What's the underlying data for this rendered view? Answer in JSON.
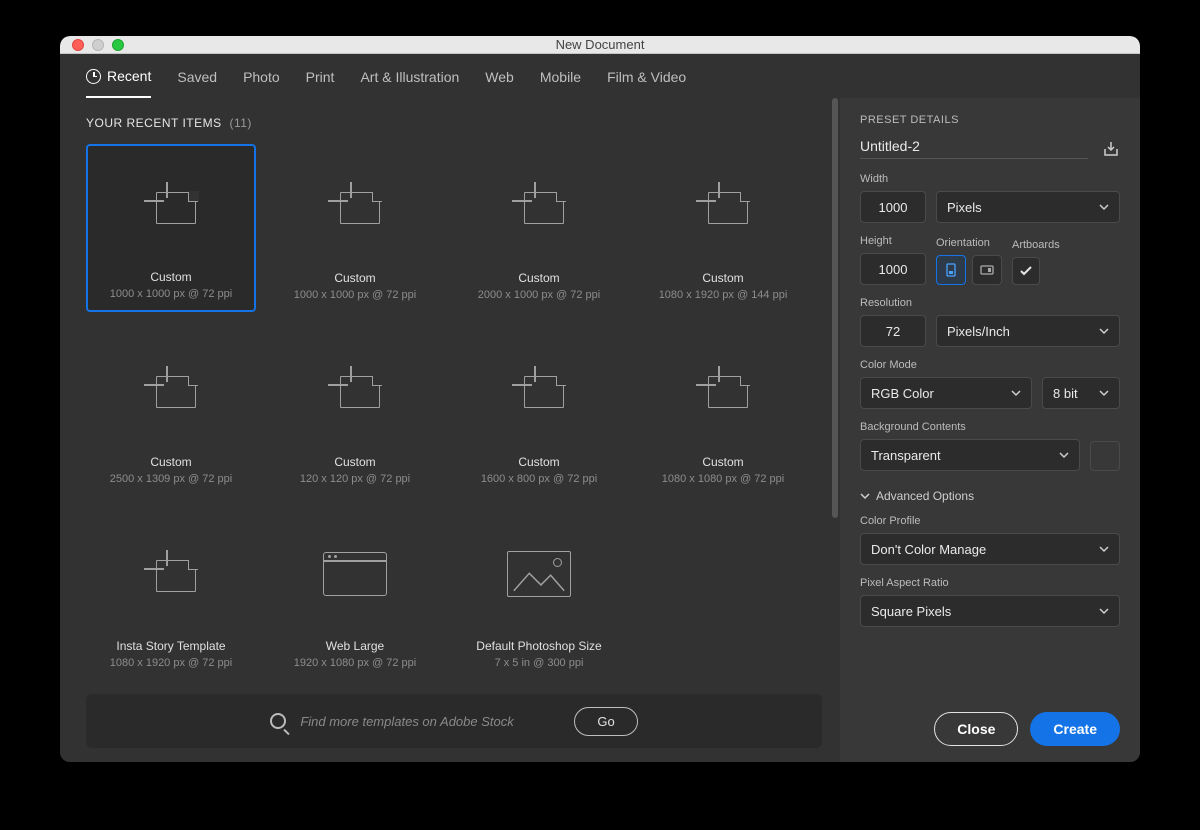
{
  "window": {
    "title": "New Document"
  },
  "tabs": [
    {
      "label": "Recent",
      "active": true
    },
    {
      "label": "Saved"
    },
    {
      "label": "Photo"
    },
    {
      "label": "Print"
    },
    {
      "label": "Art & Illustration"
    },
    {
      "label": "Web"
    },
    {
      "label": "Mobile"
    },
    {
      "label": "Film & Video"
    }
  ],
  "recent": {
    "heading": "YOUR RECENT ITEMS",
    "count": "(11)",
    "items": [
      {
        "title": "Custom",
        "sub": "1000 x 1000 px @ 72 ppi",
        "icon": "page",
        "selected": true
      },
      {
        "title": "Custom",
        "sub": "1000 x 1000 px @ 72 ppi",
        "icon": "page"
      },
      {
        "title": "Custom",
        "sub": "2000 x 1000 px @ 72 ppi",
        "icon": "page"
      },
      {
        "title": "Custom",
        "sub": "1080 x 1920 px @ 144 ppi",
        "icon": "page"
      },
      {
        "title": "Custom",
        "sub": "2500 x 1309 px @ 72 ppi",
        "icon": "page"
      },
      {
        "title": "Custom",
        "sub": "120 x 120 px @ 72 ppi",
        "icon": "page"
      },
      {
        "title": "Custom",
        "sub": "1600 x 800 px @ 72 ppi",
        "icon": "page"
      },
      {
        "title": "Custom",
        "sub": "1080 x 1080 px @ 72 ppi",
        "icon": "page"
      },
      {
        "title": "Insta Story Template",
        "sub": "1080 x 1920 px @ 72 ppi",
        "icon": "page"
      },
      {
        "title": "Web Large",
        "sub": "1920 x 1080 px @ 72 ppi",
        "icon": "browser"
      },
      {
        "title": "Default Photoshop Size",
        "sub": "7 x 5 in @ 300 ppi",
        "icon": "photo"
      }
    ]
  },
  "search": {
    "placeholder": "Find more templates on Adobe Stock",
    "go": "Go"
  },
  "preset": {
    "heading": "PRESET DETAILS",
    "docname": "Untitled-2",
    "width_label": "Width",
    "width_value": "1000",
    "width_unit": "Pixels",
    "height_label": "Height",
    "height_value": "1000",
    "orientation_label": "Orientation",
    "artboards_label": "Artboards",
    "artboards_checked": true,
    "resolution_label": "Resolution",
    "resolution_value": "72",
    "resolution_unit": "Pixels/Inch",
    "color_mode_label": "Color Mode",
    "color_mode": "RGB Color",
    "bit_depth": "8 bit",
    "bg_label": "Background Contents",
    "bg_value": "Transparent",
    "advanced_label": "Advanced Options",
    "color_profile_label": "Color Profile",
    "color_profile": "Don't Color Manage",
    "par_label": "Pixel Aspect Ratio",
    "par_value": "Square Pixels"
  },
  "buttons": {
    "close": "Close",
    "create": "Create"
  }
}
